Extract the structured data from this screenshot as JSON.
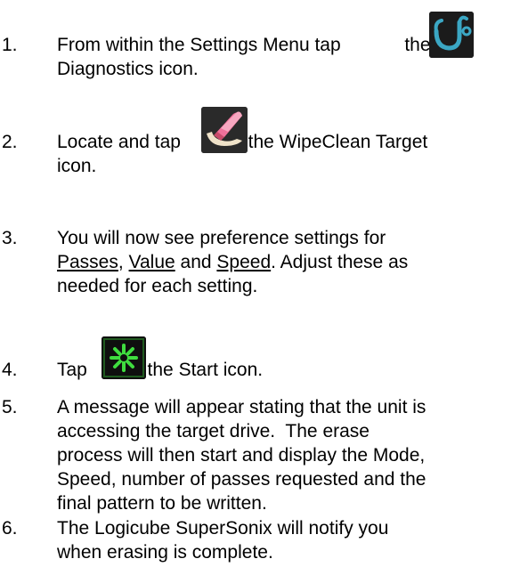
{
  "steps": [
    {
      "number": "1.",
      "line1_before_icon": "From within the Settings Menu tap",
      "line1_after_icon": "the",
      "line2": "Diagnostics icon.",
      "icon": "stethoscope-icon"
    },
    {
      "number": "2.",
      "line1_before_icon": "Locate and tap",
      "line1_after_icon": "the WipeClean Target",
      "line2": "icon.",
      "icon": "eraser-icon"
    },
    {
      "number": "3.",
      "line1": "You will now see preference settings for",
      "line2_link1": "Passes",
      "line2_sep1": ", ",
      "line2_link2": "Value",
      "line2_sep2": " and ",
      "line2_link3": "Speed",
      "line2_rest": ". Adjust these as",
      "line3": "needed for each setting."
    },
    {
      "number": "4.",
      "before_icon": "Tap",
      "after_icon": "the Start icon.",
      "icon": "start-asterisk-icon"
    },
    {
      "number": "5.",
      "lines": [
        "A message will appear stating that the unit is",
        "accessing the target drive.  The erase",
        "process will then start and display the Mode,",
        "Speed, number of passes requested and the",
        "final pattern to be written."
      ]
    },
    {
      "number": "6.",
      "lines": [
        "The Logicube SuperSonix will notify you",
        "when erasing is complete."
      ]
    }
  ],
  "colors": {
    "text": "#000000",
    "icon_dark_bg": "#1b1b1b",
    "stethoscope": "#3ba7c4",
    "eraser_pink": "#f0709a",
    "start_green": "#3fdc3f"
  }
}
